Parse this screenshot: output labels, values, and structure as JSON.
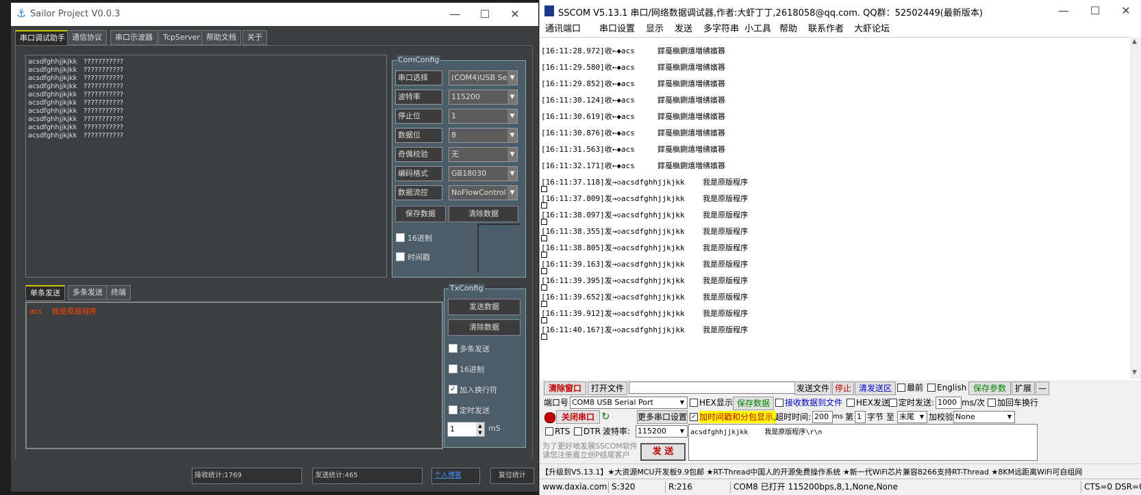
{
  "sailor": {
    "title": "Sailor Project V0.0.3",
    "tabs": [
      "串口调试助手",
      "通信协议",
      "串口示波器",
      "TcpServer",
      "帮助文档",
      "关于"
    ],
    "recv_lines": [
      "acsdfghhjjkjkk   ???????????",
      "acsdfghhjjkjkk   ???????????",
      "acsdfghhjjkjkk   ???????????",
      "acsdfghhjjkjkk   ???????????",
      "acsdfghhjjkjkk   ???????????",
      "acsdfghhjjkjkk   ???????????",
      "acsdfghhjjkjkk   ???????????",
      "acsdfghhjjkjkk   ???????????",
      "acsdfghhjjkjkk   ???????????",
      "acsdfghhjjkjkk   ???????????"
    ],
    "comconfig": {
      "title": "ComConfig",
      "rows": [
        {
          "label": "串口选择",
          "value": "(COM4)USB Seria"
        },
        {
          "label": "波特率",
          "value": "115200"
        },
        {
          "label": "停止位",
          "value": "1"
        },
        {
          "label": "数据位",
          "value": "8"
        },
        {
          "label": "奇偶校验",
          "value": "无"
        },
        {
          "label": "编码格式",
          "value": "GB18030"
        },
        {
          "label": "数据流控",
          "value": "NoFlowControl"
        }
      ],
      "save_btn": "保存数据",
      "clear_btn": "清除数据",
      "hex_chk": "16进制",
      "time_chk": "时间戳"
    },
    "send_tabs": [
      "单条发送",
      "多条发送",
      "终端"
    ],
    "send_text": "acs    我是原版程序",
    "txconfig": {
      "title": "TxConfig",
      "send_btn": "发送数据",
      "clear_btn": "清除数据",
      "multi_chk": "多条发送",
      "hex_chk": "16进制",
      "newline_chk": "加入换行符",
      "timer_chk": "定时发送",
      "interval": "1",
      "unit": "mS"
    },
    "status": {
      "recv": "接收统计:1769",
      "send": "发送统计:465",
      "link": "个人博客",
      "reset": "复位统计"
    },
    "colors": {
      "send_text": "#ff4500",
      "link": "#4a90ff"
    }
  },
  "sscom": {
    "title": "SSCOM V5.13.1 串口/网络数据调试器,作者:大虾丁丁,2618058@qq.com. QQ群：52502449(最新版本)",
    "menu": [
      "通讯端口",
      "串口设置",
      "显示",
      "发送",
      "多字符串",
      "小工具",
      "帮助",
      "联系作者",
      "大虾论坛"
    ],
    "recv_lines": [
      "[16:11:28.972]收←◆acs     鐣戞槸鍘熺増绋嬪簭",
      "[16:11:29.580]收←◆acs     鐣戞槸鍘熺増绋嬪簭",
      "[16:11:29.852]收←◆acs     鐣戞槸鍘熺増绋嬪簭",
      "[16:11:30.124]收←◆acs     鐣戞槸鍘熺増绋嬪簭",
      "[16:11:30.619]收←◆acs     鐣戞槸鍘熺増绋嬪簭",
      "[16:11:30.876]收←◆acs     鐣戞槸鍘熺増绋嬪簭",
      "[16:11:31.563]收←◆acs     鐣戞槸鍘熺増绋嬪簭",
      "[16:11:32.171]收←◆acs     鐣戞槸鍘熺増绋嬪簭"
    ],
    "send_lines": [
      "[16:11:37.118]发→◇acsdfghhjjkjkk    我是原版程序",
      "[16:11:37.809]发→◇acsdfghhjjkjkk    我是原版程序",
      "[16:11:38.097]发→◇acsdfghhjjkjkk    我是原版程序",
      "[16:11:38.355]发→◇acsdfghhjjkjkk    我是原版程序",
      "[16:11:38.805]发→◇acsdfghhjjkjkk    我是原版程序",
      "[16:11:39.163]发→◇acsdfghhjjkjkk    我是原版程序",
      "[16:11:39.395]发→◇acsdfghhjjkjkk    我是原版程序",
      "[16:11:39.652]发→◇acsdfghhjjkjkk    我是原版程序",
      "[16:11:39.912]发→◇acsdfghhjjkjkk    我是原版程序",
      "[16:11:40.167]发→◇acsdfghhjjkjkk    我是原版程序"
    ],
    "toolbar": {
      "clear_window": "清除窗口",
      "open_file": "打开文件",
      "send_file": "发送文件",
      "stop": "停止",
      "clear_send": "清发送区",
      "topmost": "最前",
      "english": "English",
      "save_params": "保存参数",
      "expand": "扩展",
      "minus": "—"
    },
    "port": {
      "label": "端口号",
      "value": "COM8 USB Serial Port",
      "hex_display": "HEX显示",
      "save_data": "保存数据",
      "recv_to_file": "接收数据到文件",
      "hex_send": "HEX发送",
      "timed_send": "定时发送:",
      "interval": "1000",
      "interval_unit": "ms/次",
      "add_crlf": "加回车换行",
      "close_port": "关闭串口",
      "more_settings": "更多串口设置",
      "timestamp": "加时间戳和分包显示,",
      "timeout_label": "超时时间:",
      "timeout": "200",
      "timeout_unit": "ms",
      "byte_no_label": "第",
      "byte_no": "1",
      "byte_label": "字节",
      "to_label": "至",
      "end_value": "末尾",
      "checksum_label": "加校验",
      "checksum": "None",
      "rts": "RTS",
      "dtr": "DTR",
      "baud_label": "波特率:",
      "baud": "115200",
      "send_text": "acsdfghhjjkjkk    我是原版程序\\r\\n",
      "promo": "为了更好地发展SSCOM软件\n请您注册嘉立创P结尾客户",
      "send_btn": "发 送"
    },
    "ticker": "【升级到V5.13.1】★大资源MCU开发板9.9包邮 ★RT-Thread中国人的开源免费操作系统 ★新一代WiFi芯片兼容8266支持RT-Thread ★8KM远距离WiFi可自组网",
    "status": {
      "site": "www.daxia.com",
      "s": "S:320",
      "r": "R:216",
      "port": "COM8 已打开  115200bps,8,1,None,None",
      "lines": "CTS=0 DSR=0"
    },
    "colors": {
      "accent_red": "#c00000",
      "highlight_yellow": "#ffff00",
      "link_blue": "#0000cc",
      "green": "#008000"
    }
  }
}
